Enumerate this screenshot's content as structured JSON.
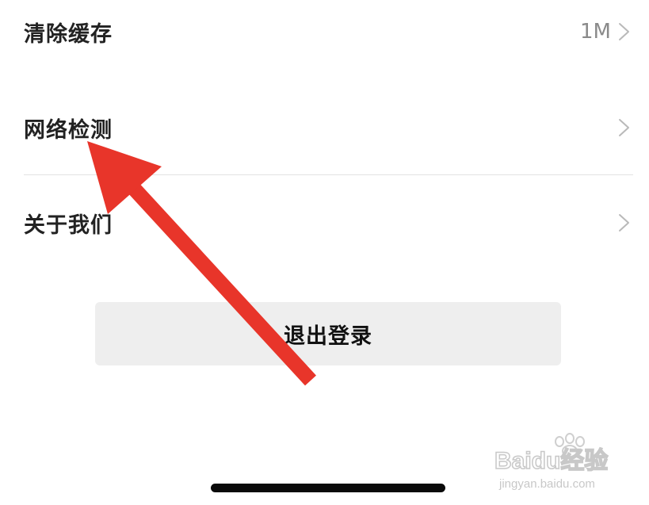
{
  "settings": {
    "items": [
      {
        "label": "清除缓存",
        "value": "1M"
      },
      {
        "label": "网络检测",
        "value": ""
      },
      {
        "label": "关于我们",
        "value": ""
      }
    ],
    "logout_label": "退出登录"
  },
  "annotation": {
    "arrow_color": "#e8352a",
    "target": "网络检测"
  },
  "watermark": {
    "logo_text": "Baidu经验",
    "url_text": "jingyan.baidu.com"
  },
  "icons": {
    "row_chevron": "chevron-right-icon",
    "watermark_paw": "baidu-paw-icon"
  }
}
